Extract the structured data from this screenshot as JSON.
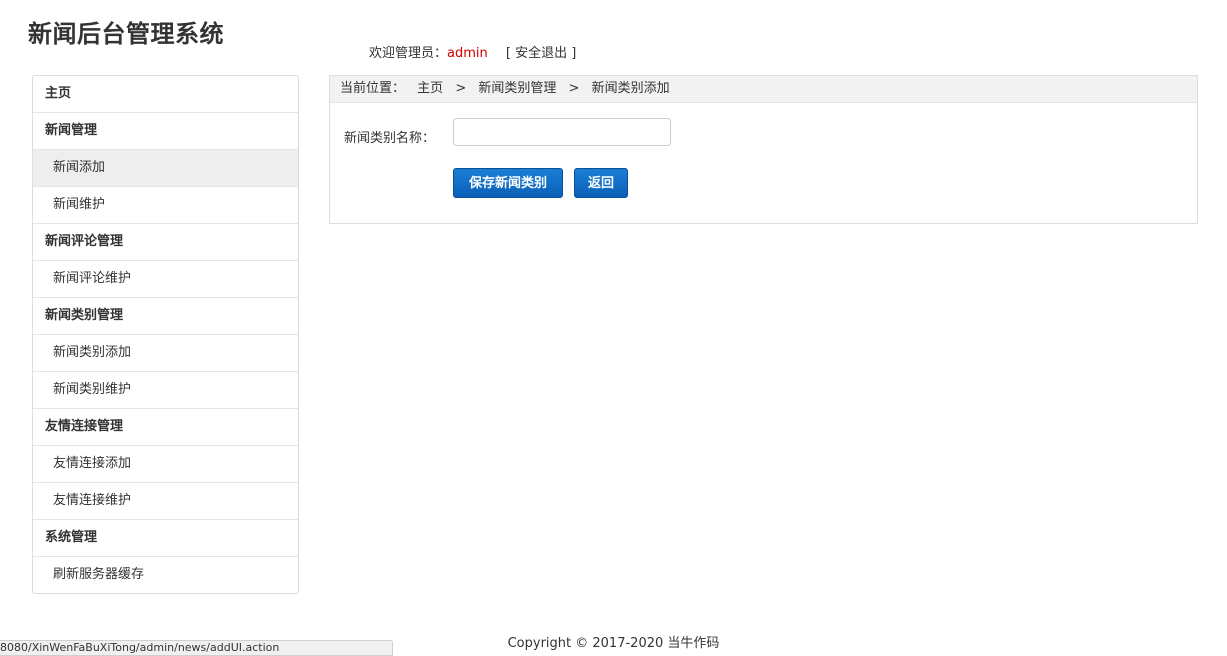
{
  "header": {
    "title": "新闻后台管理系统",
    "welcome_label": "欢迎管理员：",
    "username": "admin",
    "logout": "[ 安全退出 ]"
  },
  "sidebar": {
    "items": [
      {
        "label": "主页",
        "type": "group"
      },
      {
        "label": "新闻管理",
        "type": "group"
      },
      {
        "label": "新闻添加",
        "type": "sub"
      },
      {
        "label": "新闻维护",
        "type": "sub"
      },
      {
        "label": "新闻评论管理",
        "type": "group"
      },
      {
        "label": "新闻评论维护",
        "type": "sub"
      },
      {
        "label": "新闻类别管理",
        "type": "group"
      },
      {
        "label": "新闻类别添加",
        "type": "sub"
      },
      {
        "label": "新闻类别维护",
        "type": "sub"
      },
      {
        "label": "友情连接管理",
        "type": "group"
      },
      {
        "label": "友情连接添加",
        "type": "sub"
      },
      {
        "label": "友情连接维护",
        "type": "sub"
      },
      {
        "label": "系统管理",
        "type": "group"
      },
      {
        "label": "刷新服务器缓存",
        "type": "sub"
      }
    ]
  },
  "breadcrumb": {
    "prefix": "当前位置：",
    "items": [
      "主页",
      "新闻类别管理",
      "新闻类别添加"
    ],
    "separator": ">"
  },
  "form": {
    "name_label": "新闻类别名称：",
    "name_value": "",
    "save_label": "保存新闻类别",
    "back_label": "返回"
  },
  "footer": {
    "copyright": "Copyright © 2017-2020 当牛作码"
  },
  "status_bar": {
    "url": "8080/XinWenFaBuXiTong/admin/news/addUI.action"
  },
  "colors": {
    "username": "#d40000",
    "button": "#0a5fb8",
    "active_item_bg": "#eeeeee"
  }
}
